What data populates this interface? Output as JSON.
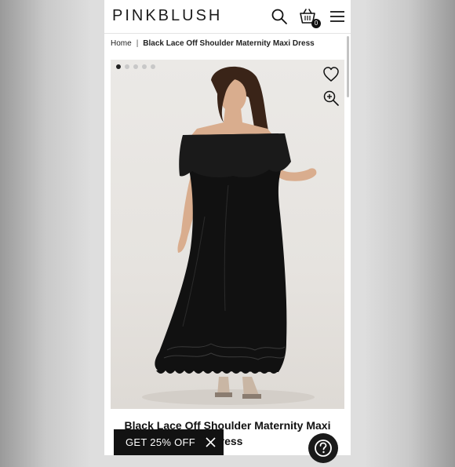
{
  "header": {
    "logo": "PINKBLUSH",
    "cart_count": "0",
    "icons": [
      "search-icon",
      "cart-icon",
      "menu-icon"
    ]
  },
  "breadcrumb": {
    "home": "Home",
    "separator": "|",
    "current": "Black Lace Off Shoulder Maternity Maxi Dress"
  },
  "gallery": {
    "slide_count": 5,
    "active_slide": 1,
    "icons": [
      "heart-icon",
      "zoom-in-icon"
    ]
  },
  "product": {
    "title_line1": "Black Lace Off Shoulder Maternity Maxi",
    "title_line2": "Dress"
  },
  "promo": {
    "label": "GET 25% OFF",
    "close_icon": "close-icon"
  },
  "help": {
    "icon": "help-icon"
  },
  "colors": {
    "brand_text": "#1b1b1b",
    "promo_bg": "#121212",
    "dress": "#111111"
  }
}
